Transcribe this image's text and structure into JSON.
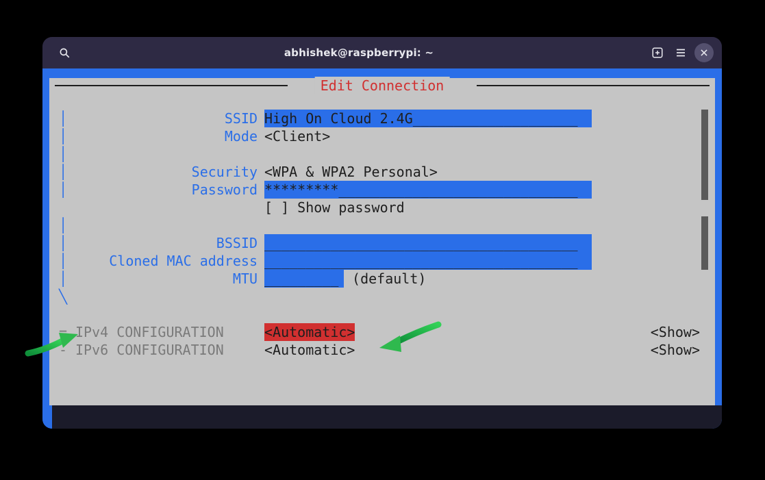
{
  "window": {
    "title": "abhishek@raspberrypi: ~"
  },
  "panel": {
    "title": "Edit Connection"
  },
  "fields": {
    "ssid_label": "SSID",
    "ssid_value": "High On Cloud 2.4G",
    "ssid_pad": "____________________",
    "mode_label": "Mode",
    "mode_value": "<Client>",
    "security_label": "Security",
    "security_value": "<WPA & WPA2 Personal>",
    "password_label": "Password",
    "password_value": "*********",
    "password_pad": "_____________________________",
    "show_password_label": "[ ] Show password",
    "bssid_label": "BSSID",
    "bssid_pad": "______________________________________",
    "cloned_mac_label": "Cloned MAC address",
    "cloned_mac_pad": "______________________________________",
    "mtu_label": "MTU",
    "mtu_pad": "_________",
    "mtu_default": " (default)"
  },
  "sections": {
    "ipv4_prefix": "=",
    "ipv4_label": "IPv4 CONFIGURATION",
    "ipv4_value": "<Automatic>",
    "ipv4_toggle": "<Show>",
    "ipv6_prefix": "-",
    "ipv6_label": "IPv6 CONFIGURATION",
    "ipv6_value": "<Automatic>",
    "ipv6_toggle": "<Show>"
  },
  "colors": {
    "accent_blue": "#2a6ee8",
    "accent_red": "#d13030",
    "panel_bg": "#c5c5c5"
  }
}
